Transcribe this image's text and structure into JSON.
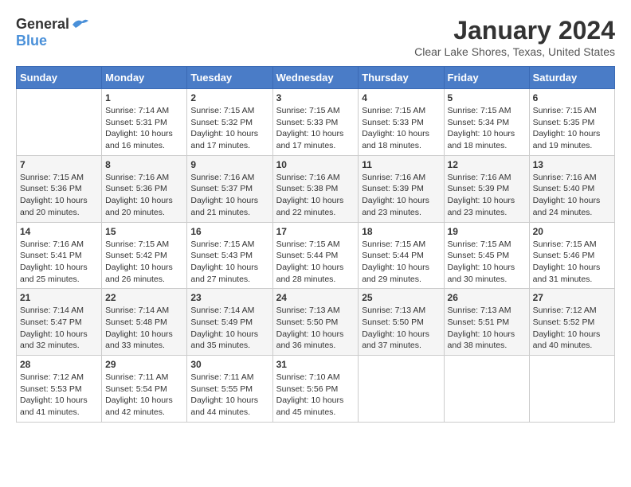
{
  "header": {
    "logo_general": "General",
    "logo_blue": "Blue",
    "title": "January 2024",
    "location": "Clear Lake Shores, Texas, United States"
  },
  "days_of_week": [
    "Sunday",
    "Monday",
    "Tuesday",
    "Wednesday",
    "Thursday",
    "Friday",
    "Saturday"
  ],
  "weeks": [
    [
      {
        "num": "",
        "sunrise": "",
        "sunset": "",
        "daylight": ""
      },
      {
        "num": "1",
        "sunrise": "Sunrise: 7:14 AM",
        "sunset": "Sunset: 5:31 PM",
        "daylight": "Daylight: 10 hours and 16 minutes."
      },
      {
        "num": "2",
        "sunrise": "Sunrise: 7:15 AM",
        "sunset": "Sunset: 5:32 PM",
        "daylight": "Daylight: 10 hours and 17 minutes."
      },
      {
        "num": "3",
        "sunrise": "Sunrise: 7:15 AM",
        "sunset": "Sunset: 5:33 PM",
        "daylight": "Daylight: 10 hours and 17 minutes."
      },
      {
        "num": "4",
        "sunrise": "Sunrise: 7:15 AM",
        "sunset": "Sunset: 5:33 PM",
        "daylight": "Daylight: 10 hours and 18 minutes."
      },
      {
        "num": "5",
        "sunrise": "Sunrise: 7:15 AM",
        "sunset": "Sunset: 5:34 PM",
        "daylight": "Daylight: 10 hours and 18 minutes."
      },
      {
        "num": "6",
        "sunrise": "Sunrise: 7:15 AM",
        "sunset": "Sunset: 5:35 PM",
        "daylight": "Daylight: 10 hours and 19 minutes."
      }
    ],
    [
      {
        "num": "7",
        "sunrise": "Sunrise: 7:15 AM",
        "sunset": "Sunset: 5:36 PM",
        "daylight": "Daylight: 10 hours and 20 minutes."
      },
      {
        "num": "8",
        "sunrise": "Sunrise: 7:16 AM",
        "sunset": "Sunset: 5:36 PM",
        "daylight": "Daylight: 10 hours and 20 minutes."
      },
      {
        "num": "9",
        "sunrise": "Sunrise: 7:16 AM",
        "sunset": "Sunset: 5:37 PM",
        "daylight": "Daylight: 10 hours and 21 minutes."
      },
      {
        "num": "10",
        "sunrise": "Sunrise: 7:16 AM",
        "sunset": "Sunset: 5:38 PM",
        "daylight": "Daylight: 10 hours and 22 minutes."
      },
      {
        "num": "11",
        "sunrise": "Sunrise: 7:16 AM",
        "sunset": "Sunset: 5:39 PM",
        "daylight": "Daylight: 10 hours and 23 minutes."
      },
      {
        "num": "12",
        "sunrise": "Sunrise: 7:16 AM",
        "sunset": "Sunset: 5:39 PM",
        "daylight": "Daylight: 10 hours and 23 minutes."
      },
      {
        "num": "13",
        "sunrise": "Sunrise: 7:16 AM",
        "sunset": "Sunset: 5:40 PM",
        "daylight": "Daylight: 10 hours and 24 minutes."
      }
    ],
    [
      {
        "num": "14",
        "sunrise": "Sunrise: 7:16 AM",
        "sunset": "Sunset: 5:41 PM",
        "daylight": "Daylight: 10 hours and 25 minutes."
      },
      {
        "num": "15",
        "sunrise": "Sunrise: 7:15 AM",
        "sunset": "Sunset: 5:42 PM",
        "daylight": "Daylight: 10 hours and 26 minutes."
      },
      {
        "num": "16",
        "sunrise": "Sunrise: 7:15 AM",
        "sunset": "Sunset: 5:43 PM",
        "daylight": "Daylight: 10 hours and 27 minutes."
      },
      {
        "num": "17",
        "sunrise": "Sunrise: 7:15 AM",
        "sunset": "Sunset: 5:44 PM",
        "daylight": "Daylight: 10 hours and 28 minutes."
      },
      {
        "num": "18",
        "sunrise": "Sunrise: 7:15 AM",
        "sunset": "Sunset: 5:44 PM",
        "daylight": "Daylight: 10 hours and 29 minutes."
      },
      {
        "num": "19",
        "sunrise": "Sunrise: 7:15 AM",
        "sunset": "Sunset: 5:45 PM",
        "daylight": "Daylight: 10 hours and 30 minutes."
      },
      {
        "num": "20",
        "sunrise": "Sunrise: 7:15 AM",
        "sunset": "Sunset: 5:46 PM",
        "daylight": "Daylight: 10 hours and 31 minutes."
      }
    ],
    [
      {
        "num": "21",
        "sunrise": "Sunrise: 7:14 AM",
        "sunset": "Sunset: 5:47 PM",
        "daylight": "Daylight: 10 hours and 32 minutes."
      },
      {
        "num": "22",
        "sunrise": "Sunrise: 7:14 AM",
        "sunset": "Sunset: 5:48 PM",
        "daylight": "Daylight: 10 hours and 33 minutes."
      },
      {
        "num": "23",
        "sunrise": "Sunrise: 7:14 AM",
        "sunset": "Sunset: 5:49 PM",
        "daylight": "Daylight: 10 hours and 35 minutes."
      },
      {
        "num": "24",
        "sunrise": "Sunrise: 7:13 AM",
        "sunset": "Sunset: 5:50 PM",
        "daylight": "Daylight: 10 hours and 36 minutes."
      },
      {
        "num": "25",
        "sunrise": "Sunrise: 7:13 AM",
        "sunset": "Sunset: 5:50 PM",
        "daylight": "Daylight: 10 hours and 37 minutes."
      },
      {
        "num": "26",
        "sunrise": "Sunrise: 7:13 AM",
        "sunset": "Sunset: 5:51 PM",
        "daylight": "Daylight: 10 hours and 38 minutes."
      },
      {
        "num": "27",
        "sunrise": "Sunrise: 7:12 AM",
        "sunset": "Sunset: 5:52 PM",
        "daylight": "Daylight: 10 hours and 40 minutes."
      }
    ],
    [
      {
        "num": "28",
        "sunrise": "Sunrise: 7:12 AM",
        "sunset": "Sunset: 5:53 PM",
        "daylight": "Daylight: 10 hours and 41 minutes."
      },
      {
        "num": "29",
        "sunrise": "Sunrise: 7:11 AM",
        "sunset": "Sunset: 5:54 PM",
        "daylight": "Daylight: 10 hours and 42 minutes."
      },
      {
        "num": "30",
        "sunrise": "Sunrise: 7:11 AM",
        "sunset": "Sunset: 5:55 PM",
        "daylight": "Daylight: 10 hours and 44 minutes."
      },
      {
        "num": "31",
        "sunrise": "Sunrise: 7:10 AM",
        "sunset": "Sunset: 5:56 PM",
        "daylight": "Daylight: 10 hours and 45 minutes."
      },
      {
        "num": "",
        "sunrise": "",
        "sunset": "",
        "daylight": ""
      },
      {
        "num": "",
        "sunrise": "",
        "sunset": "",
        "daylight": ""
      },
      {
        "num": "",
        "sunrise": "",
        "sunset": "",
        "daylight": ""
      }
    ]
  ]
}
